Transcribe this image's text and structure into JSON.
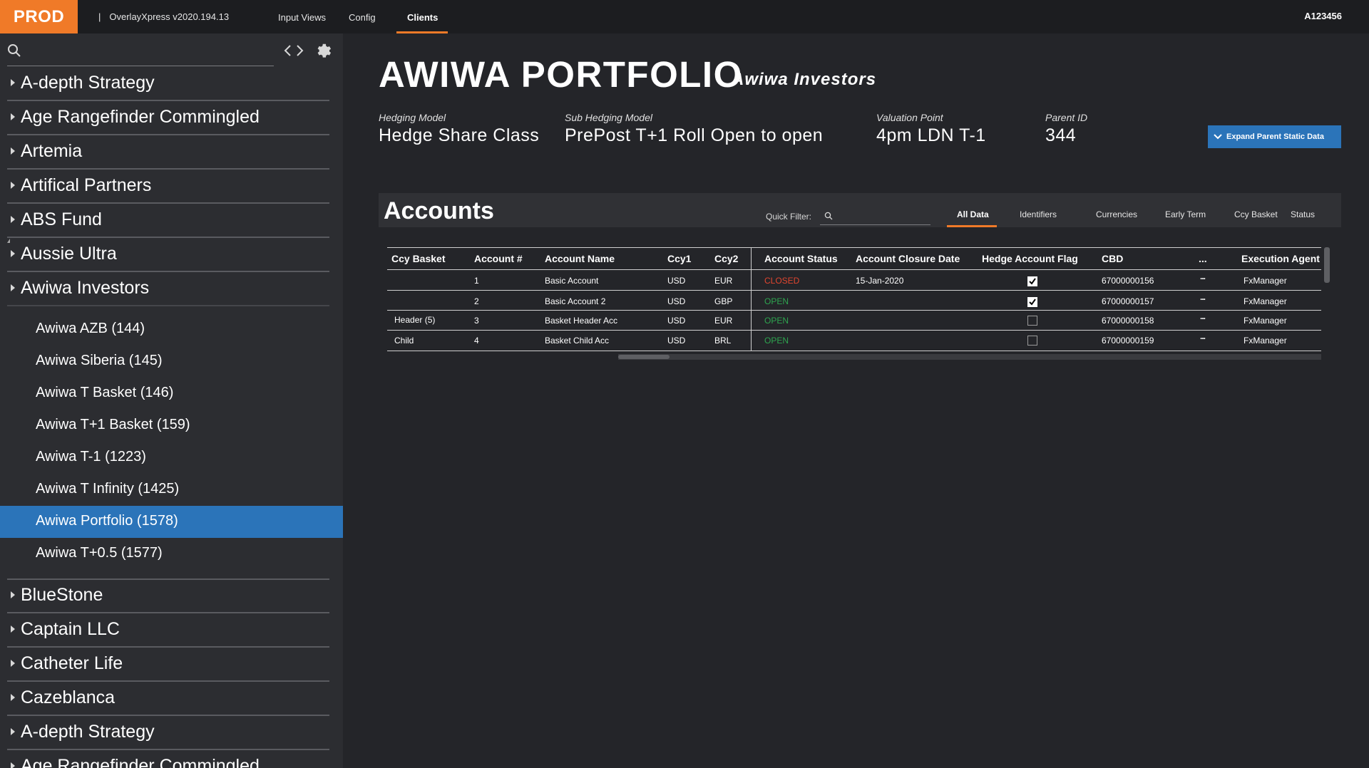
{
  "topbar": {
    "env": "PROD",
    "separator": "|",
    "app_version": "OverlayXpress v2020.194.13",
    "nav": [
      "Input Views",
      "Config",
      "Clients"
    ],
    "active_nav": "Clients",
    "user_id": "A123456"
  },
  "sidebar": {
    "search_placeholder": "",
    "items_top": [
      "A-depth Strategy",
      "Age Rangefinder Commingled",
      "Artemia",
      "Artifical Partners",
      "ABS Fund",
      "Aussie Ultra",
      "Awiwa Investors"
    ],
    "children": [
      "Awiwa AZB (144)",
      "Awiwa Siberia (145)",
      "Awiwa T Basket (146)",
      "Awiwa T+1 Basket (159)",
      "Awiwa T-1 (1223)",
      "Awiwa T Infinity (1425)",
      "Awiwa Portfolio (1578)",
      "Awiwa T+0.5 (1577)"
    ],
    "selected_child": "Awiwa Portfolio (1578)",
    "items_bottom": [
      "BlueStone",
      "Captain LLC",
      "Catheter Life",
      "Cazeblanca",
      "A-depth Strategy",
      "Age Rangefinder Commingled"
    ]
  },
  "portfolio": {
    "title": "AWIWA PORTFOLIO",
    "subtitle": "Awiwa Investors",
    "meta": [
      {
        "label": "Hedging Model",
        "value": "Hedge Share Class"
      },
      {
        "label": "Sub Hedging Model",
        "value": "PrePost T+1 Roll Open to open"
      },
      {
        "label": "Valuation Point",
        "value": "4pm LDN T-1"
      },
      {
        "label": "Parent ID",
        "value": "344"
      }
    ],
    "expand_button": "Expand Parent Static Data"
  },
  "accounts": {
    "title": "Accounts",
    "quick_filter_label": "Quick Filter:",
    "tabs": [
      "All Data",
      "Identifiers",
      "Currencies",
      "Early Term",
      "Ccy Basket",
      "Status"
    ],
    "active_tab": "All Data",
    "columns": [
      "Ccy Basket",
      "Account #",
      "Account Name",
      "Ccy1",
      "Ccy2",
      "Account Status",
      "Account Closure Date",
      "Hedge Account Flag",
      "CBD",
      "...",
      "Execution Agent"
    ],
    "rows": [
      {
        "ccy_basket": "",
        "account_no": "1",
        "name": "Basic Account",
        "ccy1": "USD",
        "ccy2": "EUR",
        "status": "CLOSED",
        "closure_date": "15-Jan-2020",
        "hedge_flag": true,
        "cbd": "67000000156",
        "more": "...",
        "agent": "FxManager"
      },
      {
        "ccy_basket": "",
        "account_no": "2",
        "name": "Basic Account 2",
        "ccy1": "USD",
        "ccy2": "GBP",
        "status": "OPEN",
        "closure_date": "",
        "hedge_flag": true,
        "cbd": "67000000157",
        "more": "...",
        "agent": "FxManager"
      },
      {
        "ccy_basket": "Header (5)",
        "account_no": "3",
        "name": "Basket Header Acc",
        "ccy1": "USD",
        "ccy2": "EUR",
        "status": "OPEN",
        "closure_date": "",
        "hedge_flag": false,
        "cbd": "67000000158",
        "more": "...",
        "agent": "FxManager"
      },
      {
        "ccy_basket": "Child",
        "account_no": "4",
        "name": "Basket Child Acc",
        "ccy1": "USD",
        "ccy2": "BRL",
        "status": "OPEN",
        "closure_date": "",
        "hedge_flag": false,
        "cbd": "67000000159",
        "more": "...",
        "agent": "FxManager"
      }
    ]
  },
  "colors": {
    "accent": "#f07a28",
    "selected": "#2b74b9",
    "closed": "#e0452f",
    "open": "#2ea44f"
  }
}
